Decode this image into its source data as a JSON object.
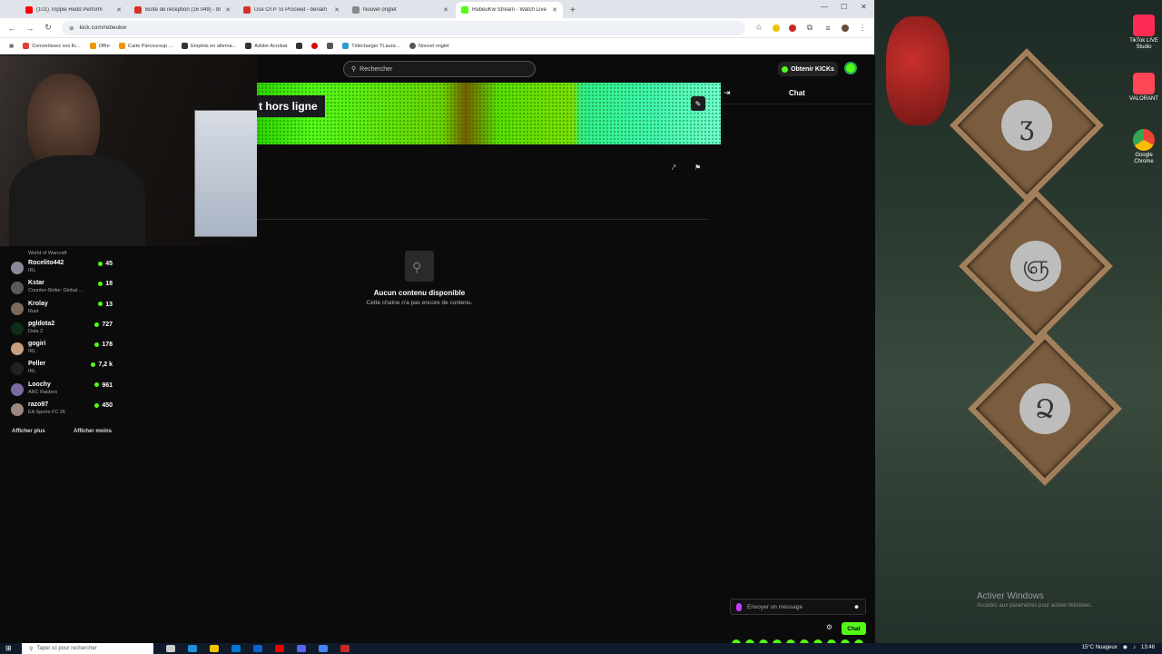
{
  "tabs": [
    {
      "title": "(101) Trippie Redd Perform",
      "color": "#ff0000"
    },
    {
      "title": "Boîte de réception (16 049) - br",
      "color": "#d93025"
    },
    {
      "title": "Use OTP To Proceed - benam",
      "color": "#d93025"
    },
    {
      "title": "Nouvel onglet",
      "color": "#666666"
    },
    {
      "title": "RebeuKw Stream - Watch Live",
      "color": "#53fc18",
      "active": true
    }
  ],
  "url": "kick.com/rebeukw",
  "bookmarks": [
    {
      "label": "Convertissez vos fic...",
      "color": "#e03c31"
    },
    {
      "label": "Offre",
      "color": "#f29400"
    },
    {
      "label": "Carte Parcoursup ...",
      "color": "#f29400"
    },
    {
      "label": "Emplois en alterna...",
      "color": "#333333"
    },
    {
      "label": "Adobe Acrobat",
      "color": "#333333"
    },
    {
      "label": "",
      "color": "#333333"
    },
    {
      "label": "",
      "color": "#e00000"
    },
    {
      "label": "",
      "color": "#555555"
    },
    {
      "label": "Télécharger TLaunc...",
      "color": "#2a9fd6"
    },
    {
      "label": "Nouvel onglet",
      "color": "#555555"
    }
  ],
  "search": {
    "placeholder": "Rechercher"
  },
  "header": {
    "kicks_label": "Obtenir KICKs"
  },
  "banner": {
    "offline_text": "t hors ligne"
  },
  "chat": {
    "title": "Chat",
    "input_placeholder": "Envoyer un message",
    "send_label": "Chat"
  },
  "empty": {
    "title": "Aucun contenu disponible",
    "subtitle": "Cette chaîne n'a pas encore de contenu."
  },
  "follow": {
    "top_category": "World of Warcraft",
    "channels": [
      {
        "name": "Rocelito442",
        "game": "IRL",
        "viewers": "45",
        "color": "#8a8a9a"
      },
      {
        "name": "Kstar",
        "game": "Counter-Strike: Global ...",
        "viewers": "18",
        "color": "#5a5a5a"
      },
      {
        "name": "Krolay",
        "game": "Rust",
        "viewers": "13",
        "color": "#7a6a5a"
      },
      {
        "name": "pgldota2",
        "game": "Dota 2",
        "viewers": "727",
        "color": "#0f2d17"
      },
      {
        "name": "gogiri",
        "game": "IRL",
        "viewers": "178",
        "color": "#c8a080"
      },
      {
        "name": "Peller",
        "game": "IRL",
        "viewers": "7,2 k",
        "color": "#222222"
      },
      {
        "name": "Loochy",
        "game": "ARC Raiders",
        "viewers": "961",
        "color": "#7a6aa0"
      },
      {
        "name": "razo97",
        "game": "EA Sports FC 26",
        "viewers": "450",
        "color": "#9a8a80"
      }
    ],
    "show_more": "Afficher plus",
    "show_less": "Afficher moins"
  },
  "desktop": {
    "icons": [
      {
        "label": "TikTok LIVE Studio",
        "color": "#fe2c55"
      },
      {
        "label": "VALORANT",
        "color": "#ff4655"
      },
      {
        "label": "Google Chrome",
        "color": "#4285f4"
      }
    ],
    "sign_glyphs": [
      "ʒ",
      "ஞ",
      "Ձ"
    ],
    "activate_title": "Activer Windows",
    "activate_sub": "Accédez aux paramètres pour activer Windows."
  },
  "taskbar": {
    "search_placeholder": "Taper ici pour rechercher",
    "weather": "15°C Nuageux",
    "time": "13:48"
  },
  "colors": {
    "accent": "#53fc18",
    "mic": "#c63cff"
  }
}
